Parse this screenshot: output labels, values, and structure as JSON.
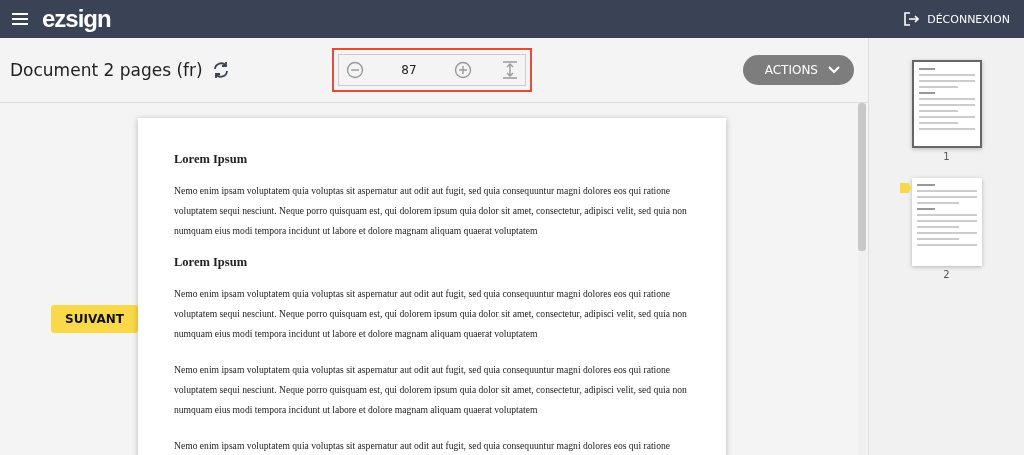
{
  "header": {
    "logo": "ezsign",
    "logout": "DÉCONNEXION"
  },
  "toolbar": {
    "title": "Document 2 pages (fr)",
    "zoom": "87",
    "actions": "ACTIONS"
  },
  "next_button": "SUIVANT",
  "document": [
    {
      "kind": "heading",
      "text": "Lorem Ipsum"
    },
    {
      "kind": "paragraph",
      "text": "Nemo enim ipsam voluptatem quia voluptas sit aspernatur aut odit aut fugit, sed quia consequuntur magni dolores eos qui ratione voluptatem sequi nesciunt. Neque porro quisquam est, qui dolorem ipsum quia dolor sit amet, consectetur, adipisci velit, sed quia non numquam eius modi tempora incidunt ut labore et dolore magnam aliquam quaerat voluptatem"
    },
    {
      "kind": "heading",
      "text": "Lorem Ipsum"
    },
    {
      "kind": "paragraph",
      "text": "Nemo enim ipsam voluptatem quia voluptas sit aspernatur aut odit aut fugit, sed quia consequuntur magni dolores eos qui ratione voluptatem sequi nesciunt. Neque porro quisquam est, qui dolorem ipsum quia dolor sit amet, consectetur, adipisci velit, sed quia non numquam eius modi tempora incidunt ut labore et dolore magnam aliquam quaerat voluptatem"
    },
    {
      "kind": "paragraph",
      "text": "Nemo enim ipsam voluptatem quia voluptas sit aspernatur aut odit aut fugit, sed quia consequuntur magni dolores eos qui ratione voluptatem sequi nesciunt. Neque porro quisquam est, qui dolorem ipsum quia dolor sit amet, consectetur, adipisci velit, sed quia non numquam eius modi tempora incidunt ut labore et dolore magnam aliquam quaerat voluptatem"
    },
    {
      "kind": "paragraph",
      "text": "Nemo enim ipsam voluptatem quia voluptas sit aspernatur aut odit aut fugit, sed quia consequuntur magni dolores eos qui ratione"
    }
  ],
  "thumbnails": [
    {
      "label": "1",
      "selected": true,
      "flagged": false
    },
    {
      "label": "2",
      "selected": false,
      "flagged": true
    }
  ]
}
